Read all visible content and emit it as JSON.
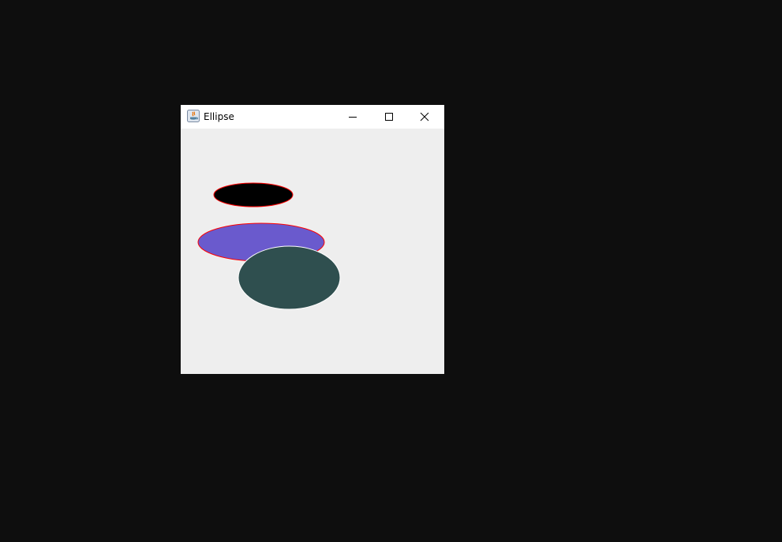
{
  "window": {
    "title": "Ellipse",
    "app_icon": "java-icon",
    "controls": {
      "minimize": "minimize-icon",
      "maximize": "maximize-icon",
      "close": "close-icon"
    }
  },
  "canvas": {
    "background": "#eeeeee",
    "shapes": [
      {
        "name": "black-ellipse",
        "fill": "#000000",
        "stroke": "#ff0000"
      },
      {
        "name": "purple-ellipse",
        "fill": "#6a5acd",
        "stroke": "#ff0000"
      },
      {
        "name": "dark-slate-ellipse",
        "fill": "#2f4f4f",
        "stroke": "#ffffff"
      }
    ]
  }
}
